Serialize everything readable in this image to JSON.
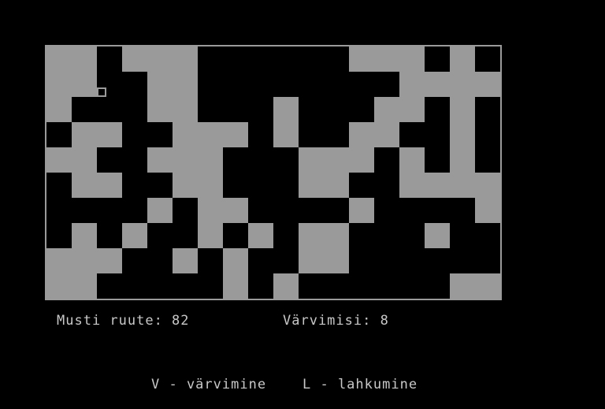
{
  "status": {
    "black_squares": "Musti ruute: 82",
    "colorings": "Värvimisi: 8"
  },
  "help": {
    "color_key": "V - värvimine",
    "solve_key": "L - lahkumine"
  },
  "board": {
    "rows": 10,
    "cols": 18,
    "cells": [
      "001000111111000101",
      "001100111111110000",
      "011100111011100101",
      "100110001011001101",
      "001100011100010101",
      "100110011100110000",
      "111101001111011110",
      "101011010100111011",
      "000110101100111111",
      "001111101011111100"
    ],
    "cursor": {
      "row": 1,
      "col": 2
    },
    "colors": {
      "black": "#000000",
      "gray": "#9a9a9a"
    }
  }
}
